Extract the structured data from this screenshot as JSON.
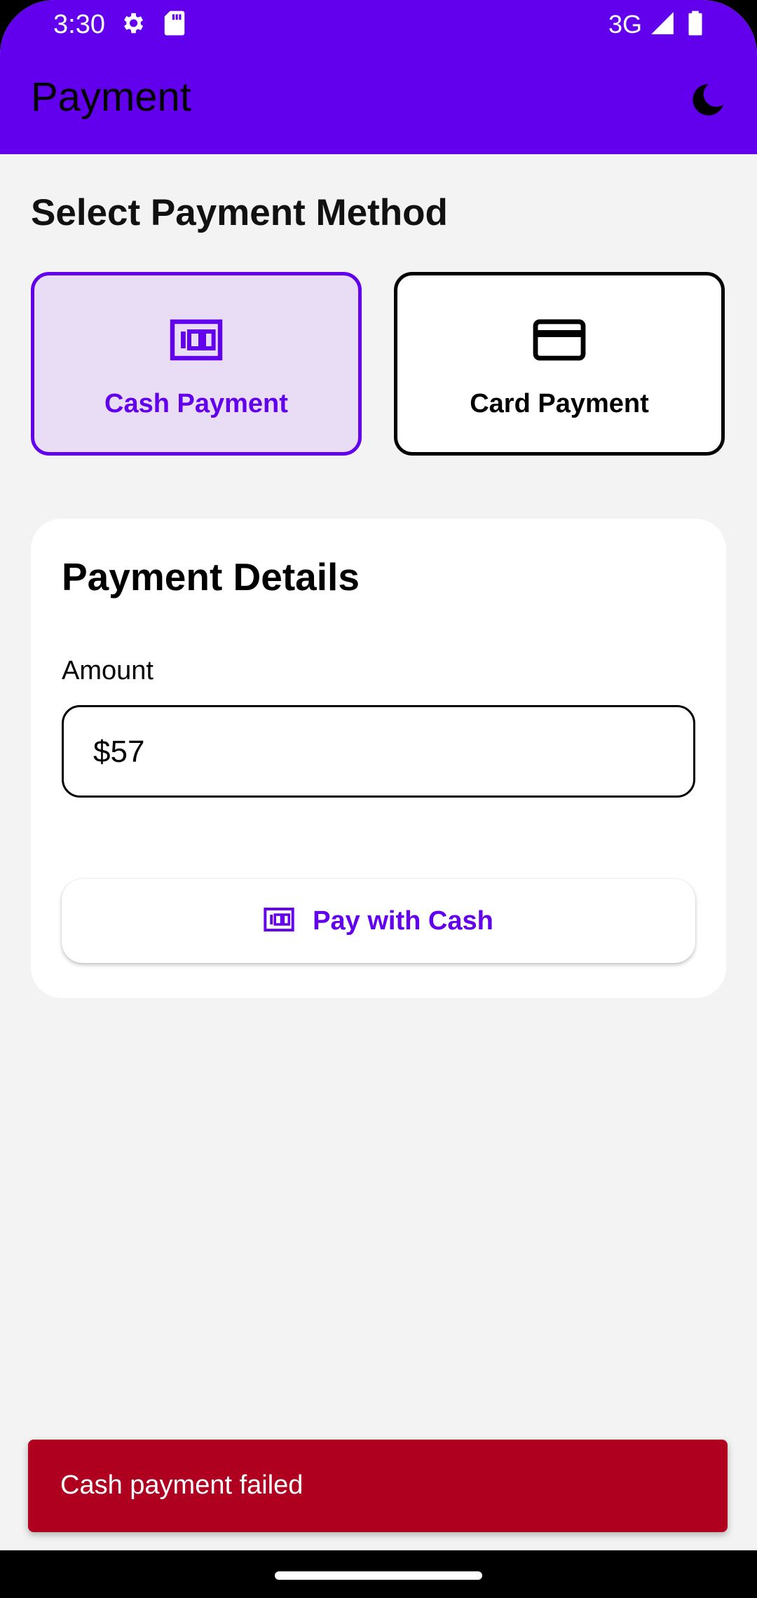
{
  "status_bar": {
    "time": "3:30",
    "network": "3G",
    "icons": [
      "gear-icon",
      "sd-card-icon",
      "signal-icon",
      "battery-icon"
    ]
  },
  "app_bar": {
    "title": "Payment",
    "theme_toggle_icon": "moon-icon"
  },
  "method_section": {
    "title": "Select Payment Method",
    "methods": [
      {
        "label": "Cash Payment",
        "icon": "cash-icon",
        "selected": true
      },
      {
        "label": "Card Payment",
        "icon": "credit-card-icon",
        "selected": false
      }
    ]
  },
  "details": {
    "title": "Payment Details",
    "amount_label": "Amount",
    "amount_value": "$57",
    "pay_button_label": "Pay with Cash",
    "pay_button_icon": "cash-icon"
  },
  "snackbar": {
    "message": "Cash payment failed",
    "color": "#b00020"
  },
  "colors": {
    "primary": "#6200ee",
    "selected_card_bg": "#e9ddf5",
    "background": "#f3f3f3"
  }
}
